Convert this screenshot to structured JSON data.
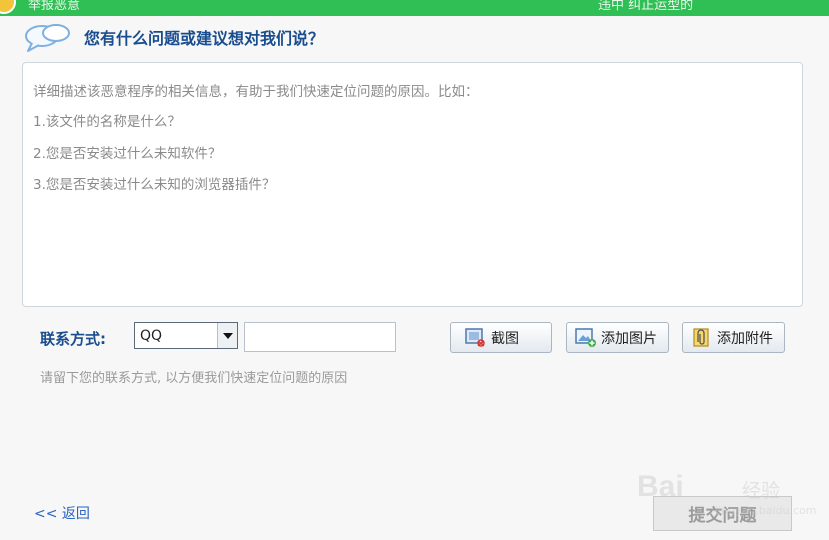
{
  "topbar": {
    "left_text": "举报恶意",
    "right_text": "违中 纠正运型的"
  },
  "form": {
    "heading": "您有什么问题或建议想对我们说？",
    "description_lines": [
      "详细描述该恶意程序的相关信息，有助于我们快速定位问题的原因。比如：",
      "1.该文件的名称是什么？",
      "2.您是否安装过什么未知软件？",
      "3.您是否安装过什么未知的浏览器插件？"
    ],
    "contact_label": "联系方式:",
    "contact_type": "QQ",
    "contact_value": "",
    "hint": "请留下您的联系方式, 以方便我们快速定位问题的原因"
  },
  "buttons": {
    "screenshot": "截图",
    "add_image": "添加图片",
    "add_attachment": "添加附件",
    "back": "<< 返回",
    "submit": "提交问题"
  },
  "watermark": {
    "text": "Bai",
    "sub": "经验",
    "url": "jingyan.baidu.com"
  },
  "icons": {
    "heading": "speech-bubbles-icon",
    "screenshot": "screenshot-icon",
    "add_image": "add-image-icon",
    "add_attachment": "attachment-icon",
    "dropdown": "chevron-down-icon"
  },
  "colors": {
    "accent_green": "#2fbf54",
    "heading_blue": "#1a4d8f",
    "link_blue": "#2a64c4"
  }
}
